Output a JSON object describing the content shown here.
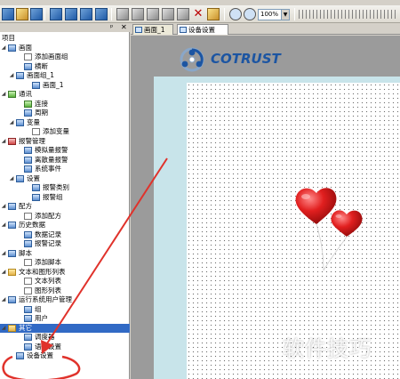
{
  "toolbar": {
    "zoom_value": "100%"
  },
  "project_panel": {
    "pin_glyph": "ᵖ",
    "close_glyph": "✕",
    "tree": [
      {
        "label": "项目",
        "level": 0,
        "icon": "none",
        "expander": ""
      },
      {
        "label": "画面",
        "level": 0,
        "icon": "screen-icon",
        "expander": "◢"
      },
      {
        "label": "添加画面组",
        "level": 2,
        "icon": "add-group-icon",
        "expander": ""
      },
      {
        "label": "横断",
        "level": 2,
        "icon": "screen-icon",
        "expander": ""
      },
      {
        "label": "画面组_1",
        "level": 1,
        "icon": "screen-group-icon",
        "expander": "◢"
      },
      {
        "label": "画面_1",
        "level": 3,
        "icon": "screen-icon",
        "expander": ""
      },
      {
        "label": "通讯",
        "level": 0,
        "icon": "comm-icon",
        "expander": "◢"
      },
      {
        "label": "连接",
        "level": 2,
        "icon": "connection-icon",
        "expander": ""
      },
      {
        "label": "周期",
        "level": 2,
        "icon": "cycle-icon",
        "expander": ""
      },
      {
        "label": "变量",
        "level": 1,
        "icon": "variable-icon",
        "expander": "◢"
      },
      {
        "label": "添加变量",
        "level": 3,
        "icon": "add-variable-icon",
        "expander": ""
      },
      {
        "label": "报警管理",
        "level": 0,
        "icon": "alarm-icon",
        "expander": "◢"
      },
      {
        "label": "模拟量报警",
        "level": 2,
        "icon": "analog-alarm-icon",
        "expander": ""
      },
      {
        "label": "离散量报警",
        "level": 2,
        "icon": "discrete-alarm-icon",
        "expander": ""
      },
      {
        "label": "系统事件",
        "level": 2,
        "icon": "system-event-icon",
        "expander": ""
      },
      {
        "label": "设置",
        "level": 1,
        "icon": "settings-icon",
        "expander": "◢"
      },
      {
        "label": "报警类别",
        "level": 3,
        "icon": "alarm-class-icon",
        "expander": ""
      },
      {
        "label": "报警组",
        "level": 3,
        "icon": "alarm-group-icon",
        "expander": ""
      },
      {
        "label": "配方",
        "level": 0,
        "icon": "recipe-icon",
        "expander": "◢"
      },
      {
        "label": "添加配方",
        "level": 2,
        "icon": "add-recipe-icon",
        "expander": ""
      },
      {
        "label": "历史数据",
        "level": 0,
        "icon": "history-icon",
        "expander": "◢"
      },
      {
        "label": "数据记录",
        "level": 2,
        "icon": "data-log-icon",
        "expander": ""
      },
      {
        "label": "报警记录",
        "level": 2,
        "icon": "alarm-log-icon",
        "expander": ""
      },
      {
        "label": "脚本",
        "level": 0,
        "icon": "script-icon",
        "expander": "◢"
      },
      {
        "label": "添加脚本",
        "level": 2,
        "icon": "add-script-icon",
        "expander": ""
      },
      {
        "label": "文本和图形列表",
        "level": 0,
        "icon": "list-icon",
        "expander": "◢"
      },
      {
        "label": "文本列表",
        "level": 2,
        "icon": "text-list-icon",
        "expander": ""
      },
      {
        "label": "图形列表",
        "level": 2,
        "icon": "graphic-list-icon",
        "expander": ""
      },
      {
        "label": "运行系统用户管理",
        "level": 0,
        "icon": "user-admin-icon",
        "expander": "◢"
      },
      {
        "label": "组",
        "level": 2,
        "icon": "group-icon",
        "expander": ""
      },
      {
        "label": "用户",
        "level": 2,
        "icon": "user-icon",
        "expander": ""
      },
      {
        "label": "其它",
        "level": 0,
        "icon": "other-icon",
        "expander": "◢",
        "selected": true
      },
      {
        "label": "调度器",
        "level": 2,
        "icon": "scheduler-icon",
        "expander": ""
      },
      {
        "label": "语言设置",
        "level": 2,
        "icon": "language-icon",
        "expander": ""
      },
      {
        "label": "设备设置",
        "level": 1,
        "icon": "device-settings-icon",
        "expander": ""
      }
    ]
  },
  "tabs": [
    {
      "label": "画面_1",
      "active": false
    },
    {
      "label": "设备设置",
      "active": true
    }
  ],
  "logo": {
    "word": "COTRUST"
  },
  "watermark": "软件技巧",
  "colors": {
    "selection": "#316ac5",
    "brand": "#1c55a2",
    "annotation": "#e0322b",
    "canvas_frame": "#c8e4ea"
  }
}
